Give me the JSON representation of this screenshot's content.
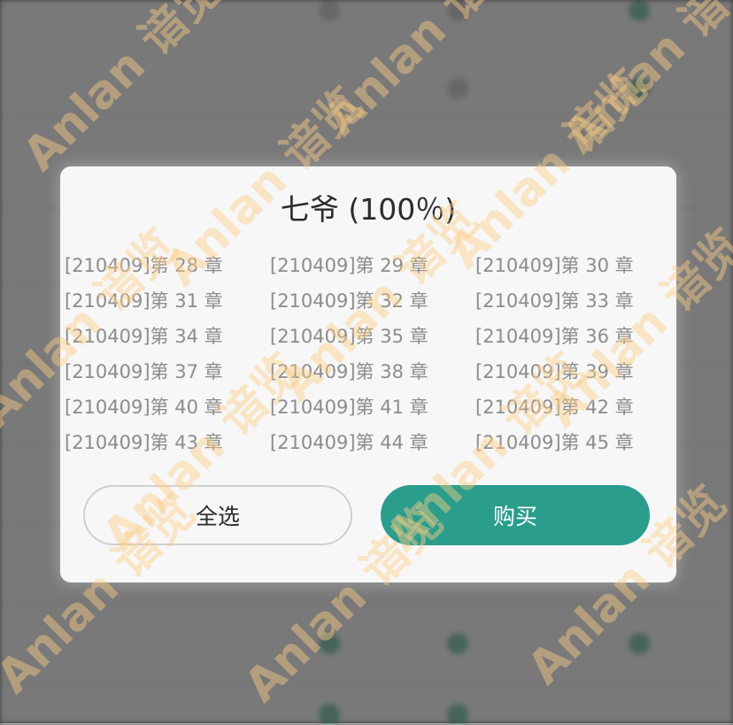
{
  "dialog": {
    "title": "七爷 (100％)",
    "chapters": [
      "[210409]第 28 章",
      "[210409]第 29 章",
      "[210409]第 30 章",
      "[210409]第 31 章",
      "[210409]第 32 章",
      "[210409]第 33 章",
      "[210409]第 34 章",
      "[210409]第 35 章",
      "[210409]第 36 章",
      "[210409]第 37 章",
      "[210409]第 38 章",
      "[210409]第 39 章",
      "[210409]第 40 章",
      "[210409]第 41 章",
      "[210409]第 42 章",
      "[210409]第 43 章",
      "[210409]第 44 章",
      "[210409]第 45 章"
    ],
    "select_all_label": "全选",
    "buy_label": "购买"
  },
  "watermark": {
    "text": "Anlan 谙览"
  },
  "colors": {
    "buy_button": "#2a9d8c",
    "dialog_bg": "#f7f7f7",
    "chapter_text": "#8c8c8c"
  }
}
